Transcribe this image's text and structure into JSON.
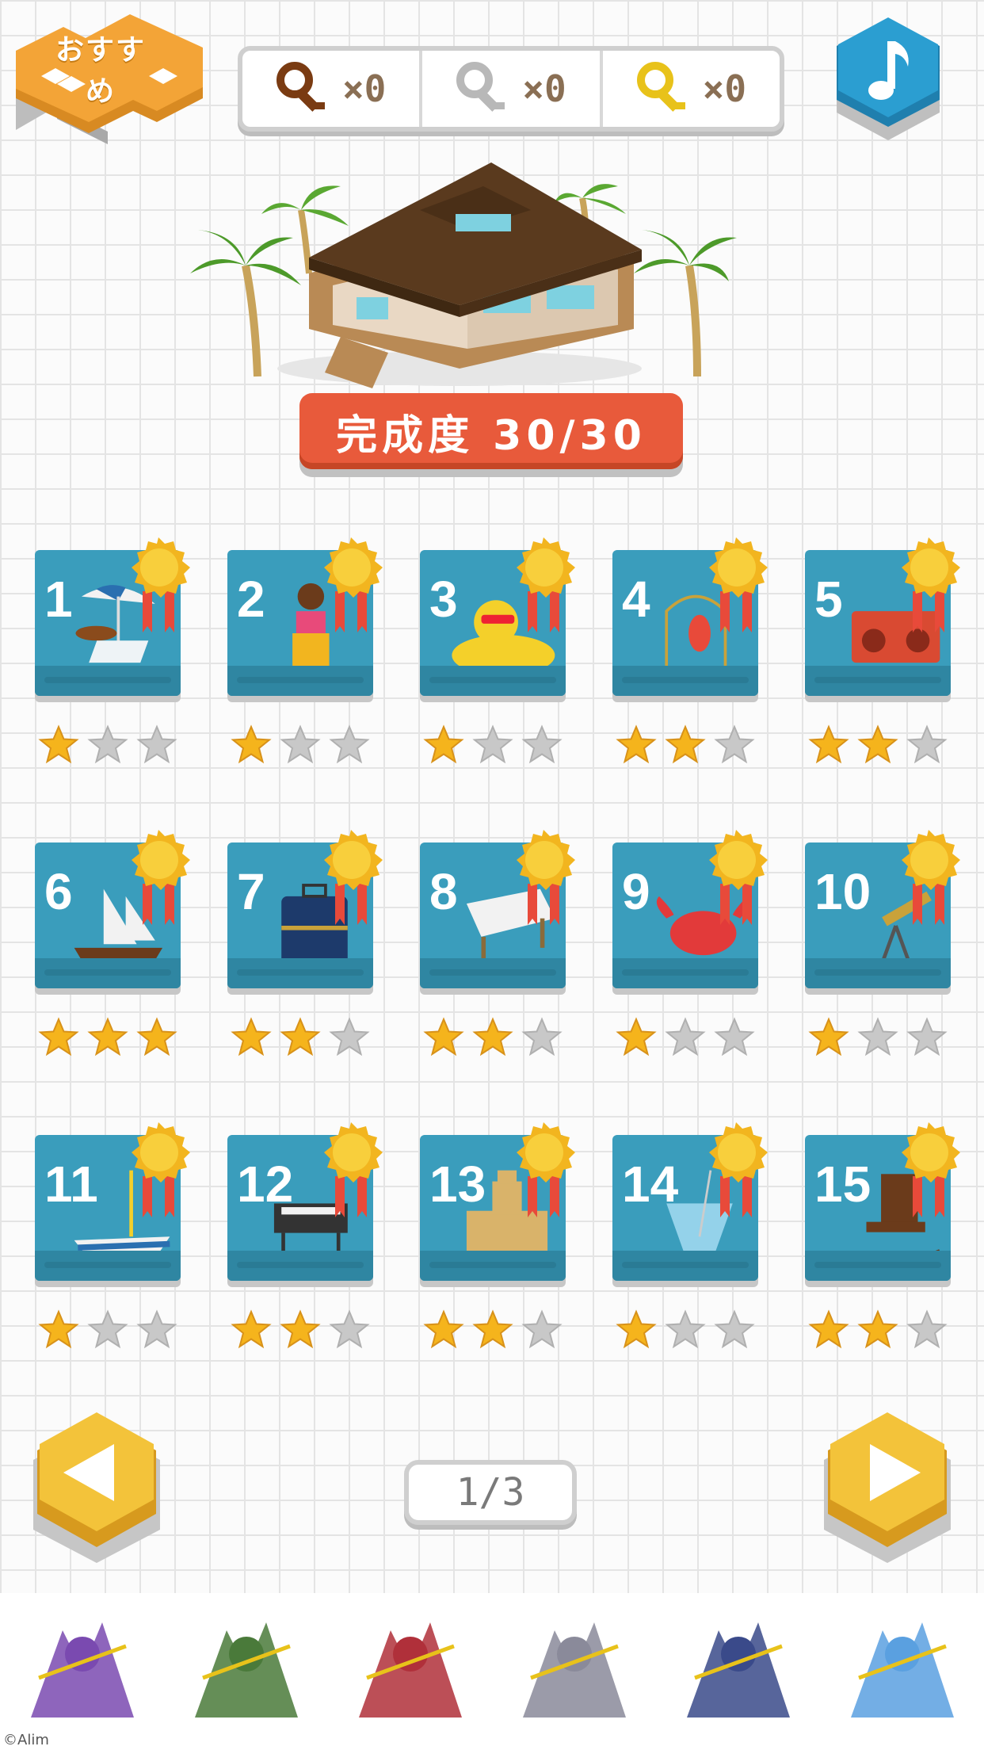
{
  "header": {
    "recommend_label": "おすすめ",
    "keys": [
      {
        "name": "bronze-key",
        "color": "#7a3b12",
        "count": "×0"
      },
      {
        "name": "silver-key",
        "color": "#b8b8b8",
        "count": "×0"
      },
      {
        "name": "gold-key",
        "color": "#e8c21a",
        "count": "×0"
      }
    ],
    "music_icon": "music-note-icon"
  },
  "completion": {
    "label": "完成度 30/30"
  },
  "stages": [
    {
      "number": "1",
      "item": "beach-parasol-table",
      "stars": 1
    },
    {
      "number": "2",
      "item": "hula-girl",
      "stars": 1
    },
    {
      "number": "3",
      "item": "rubber-duck-float",
      "stars": 1
    },
    {
      "number": "4",
      "item": "parrot-cage",
      "stars": 2
    },
    {
      "number": "5",
      "item": "radio-cassette",
      "stars": 2
    },
    {
      "number": "6",
      "item": "sailing-ship",
      "stars": 3
    },
    {
      "number": "7",
      "item": "suitcase",
      "stars": 2
    },
    {
      "number": "8",
      "item": "picnic-table",
      "stars": 2
    },
    {
      "number": "9",
      "item": "crab",
      "stars": 1
    },
    {
      "number": "10",
      "item": "telescope",
      "stars": 1
    },
    {
      "number": "11",
      "item": "yacht",
      "stars": 1
    },
    {
      "number": "12",
      "item": "bbq-grill",
      "stars": 2
    },
    {
      "number": "13",
      "item": "sand-castle",
      "stars": 2
    },
    {
      "number": "14",
      "item": "tropical-drink",
      "stars": 1
    },
    {
      "number": "15",
      "item": "rocking-chair",
      "stars": 2
    }
  ],
  "pagination": {
    "page_label": "1/3"
  },
  "ad": {
    "copyright": "©Alim",
    "characters": [
      "dragon-warrior",
      "green-dragon",
      "red-knight",
      "skull-warrior",
      "dark-swordsman",
      "blue-angel"
    ]
  },
  "colors": {
    "accent_orange": "#f3a437",
    "music_blue": "#2b9ed1",
    "banner_red": "#e85a3b",
    "card_teal": "#3a9dbc",
    "nav_yellow": "#f3c33a",
    "star_gold": "#f5b41c",
    "star_empty": "#c8c8c8"
  }
}
